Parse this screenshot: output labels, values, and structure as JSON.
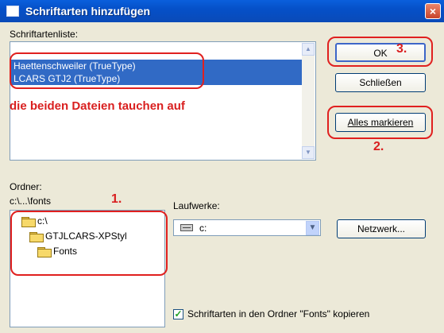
{
  "window": {
    "title": "Schriftarten hinzufügen",
    "close_glyph": "×"
  },
  "font_list": {
    "label": "Schriftartenliste:",
    "items": [
      "Haettenschweiler (TrueType)",
      "LCARS GTJ2 (TrueType)"
    ],
    "annotation": "die beiden Dateien tauchen auf"
  },
  "buttons": {
    "ok": "OK",
    "close": "Schließen",
    "select_all": "Alles markieren",
    "network": "Netzwerk..."
  },
  "folder": {
    "label": "Ordner:",
    "path": "c:\\...\\fonts",
    "tree": [
      {
        "name": "c:\\",
        "icon": "open-folder-icon"
      },
      {
        "name": "GTJLCARS-XPStyl",
        "icon": "open-folder-icon"
      },
      {
        "name": "Fonts",
        "icon": "open-folder-icon"
      }
    ]
  },
  "drives": {
    "label": "Laufwerke:",
    "value": "c:",
    "icon": "drive-icon"
  },
  "copy_option": {
    "label": "Schriftarten in den Ordner \"Fonts\" kopieren",
    "checked": true
  },
  "annotations": {
    "step1": "1.",
    "step2": "2.",
    "step3": "3."
  },
  "colors": {
    "annotation_red": "#e0201f",
    "titlebar_blue": "#0550c8",
    "selection_blue": "#316ac5"
  }
}
